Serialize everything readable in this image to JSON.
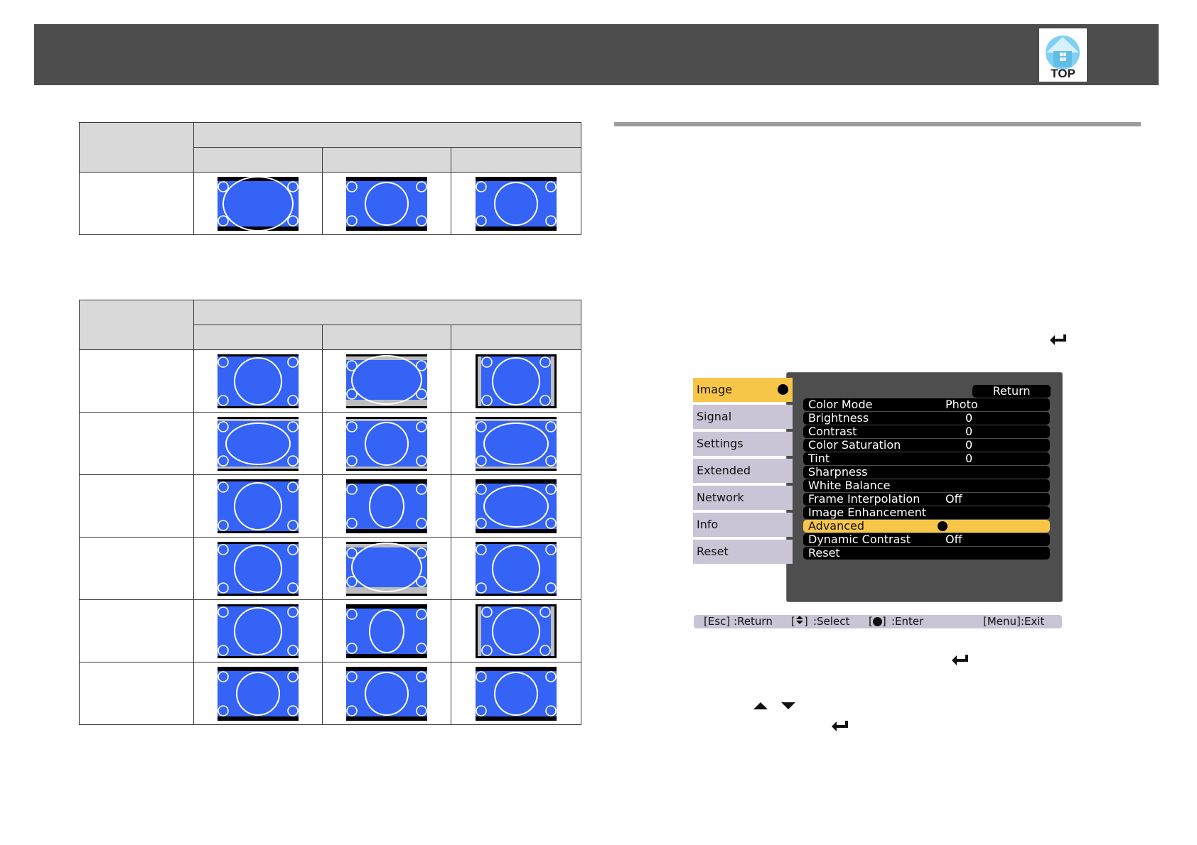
{
  "header": {
    "top_button_label": "TOP"
  },
  "colors": {
    "header": "#4d4d4d",
    "screen": "#3463f5",
    "menu_highlight": "#f7c648",
    "menu_tab": "#c9c4d6"
  },
  "table1": {
    "columns": 3,
    "rows": [
      [
        "lb-wide",
        "lb-square",
        "lb-square"
      ]
    ]
  },
  "table2": {
    "columns": 3,
    "rows": [
      [
        "full-square",
        "lb-wide-gray",
        "pillar"
      ],
      [
        "wide-ellipse-gray",
        "mid-square-gray",
        "wide-ellipse-gray"
      ],
      [
        "full-square",
        "tall-ellipse",
        "wide-ellipse"
      ],
      [
        "full-square",
        "lb-wide-gray",
        "full-square"
      ],
      [
        "full-square",
        "tall-ellipse-bottom",
        "pillar"
      ],
      [
        "lb-square",
        "lb-square",
        "lb-square"
      ]
    ]
  },
  "menu": {
    "sidebar": [
      {
        "label": "Image",
        "active": true
      },
      {
        "label": "Signal",
        "active": false
      },
      {
        "label": "Settings",
        "active": false
      },
      {
        "label": "Extended",
        "active": false
      },
      {
        "label": "Network",
        "active": false
      },
      {
        "label": "Info",
        "active": false
      },
      {
        "label": "Reset",
        "active": false
      }
    ],
    "return_label": "Return",
    "items": [
      {
        "label": "Color Mode",
        "value": "Photo"
      },
      {
        "label": "Brightness",
        "value": "0",
        "numeric": true
      },
      {
        "label": "Contrast",
        "value": "0",
        "numeric": true
      },
      {
        "label": "Color Saturation",
        "value": "0",
        "numeric": true
      },
      {
        "label": "Tint",
        "value": "0",
        "numeric": true
      },
      {
        "label": "Sharpness",
        "value": ""
      },
      {
        "label": "White Balance",
        "value": ""
      },
      {
        "label": "Frame Interpolation",
        "value": "Off"
      },
      {
        "label": "Image Enhancement",
        "value": ""
      },
      {
        "label": "Advanced",
        "value": "",
        "selected": true
      },
      {
        "label": "Dynamic Contrast",
        "value": "Off"
      },
      {
        "label": "Reset",
        "value": ""
      }
    ],
    "hints": {
      "esc": "[Esc] :Return",
      "select": ":Select",
      "enter": ":Enter",
      "exit": "[Menu]:Exit"
    }
  }
}
